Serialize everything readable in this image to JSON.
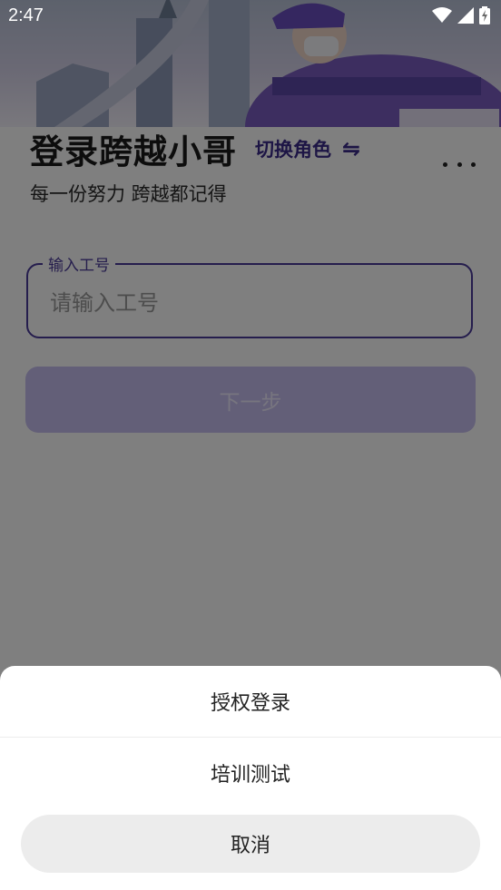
{
  "status_bar": {
    "time": "2:47"
  },
  "login": {
    "title": "登录跨越小哥",
    "switch_role": "切换角色",
    "switch_icon": "⇋",
    "subtitle": "每一份努力 跨越都记得",
    "field_label": "输入工号",
    "field_placeholder": "请输入工号",
    "next_button": "下一步"
  },
  "sheet": {
    "item1": "授权登录",
    "item2": "培训测试",
    "cancel": "取消"
  }
}
